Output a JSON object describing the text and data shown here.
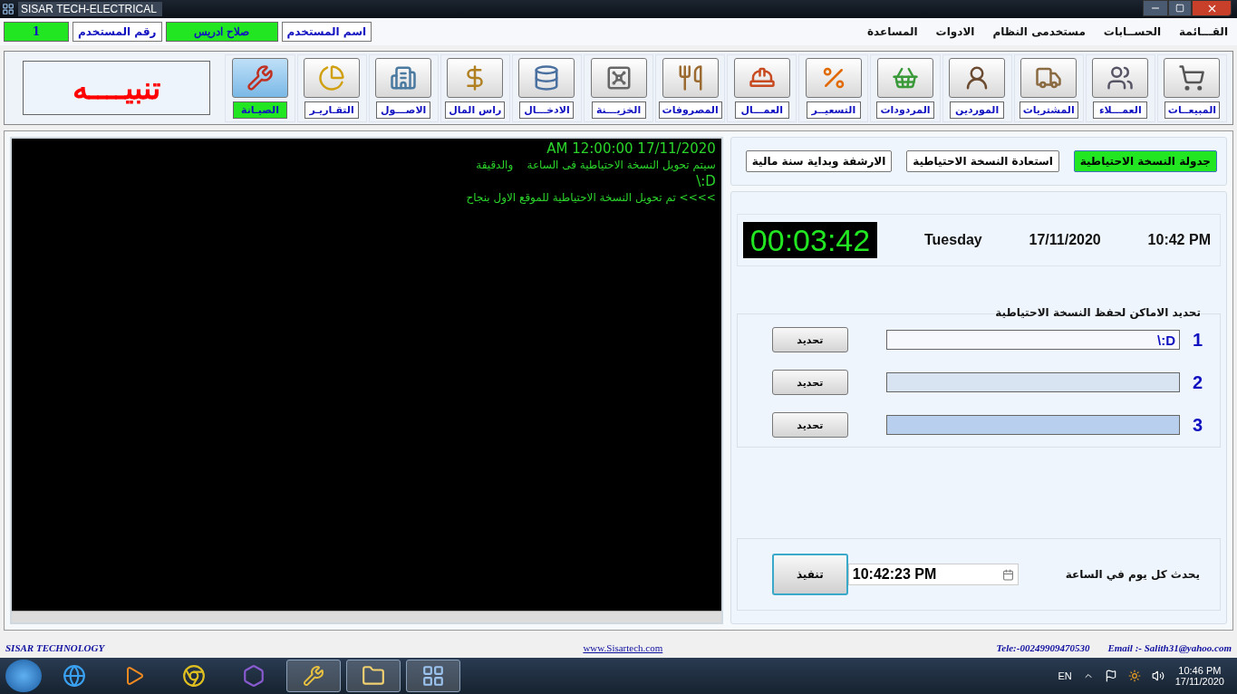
{
  "window": {
    "title": "SISAR TECH-ELECTRICAL"
  },
  "user": {
    "number_label": "رقم المستخدم",
    "number": "1",
    "name_label": "اسم المستخدم",
    "name": "صلاح ادريس"
  },
  "menu": [
    "القـــائمة",
    "الحســابات",
    "مستخدمى النظام",
    "الادوات",
    "المساعدة"
  ],
  "toolbar": [
    {
      "label": "المبيعــات",
      "selected": false
    },
    {
      "label": "العمـــلاء",
      "selected": false
    },
    {
      "label": "المشتريات",
      "selected": false
    },
    {
      "label": "الموردين",
      "selected": false
    },
    {
      "label": "المردودات",
      "selected": false
    },
    {
      "label": "التسعيــر",
      "selected": false
    },
    {
      "label": "العمـــال",
      "selected": false
    },
    {
      "label": "المصروفات",
      "selected": false
    },
    {
      "label": "الخزيـــنة",
      "selected": false
    },
    {
      "label": "الادخـــال",
      "selected": false
    },
    {
      "label": "راس المال",
      "selected": false
    },
    {
      "label": "الاصـــول",
      "selected": false
    },
    {
      "label": "التقـاريـر",
      "selected": false
    },
    {
      "label": "الصيـانة",
      "selected": true
    }
  ],
  "alert": "تنبيــــه",
  "console": [
    {
      "kind": "stamp",
      "text": "AM 12:00:00 17/11/2020"
    },
    {
      "kind": "message",
      "text": "سيتم تحويل النسخة الاحتياطية فى الساعة    والدقيقة"
    },
    {
      "kind": "path",
      "text": "\\:D"
    },
    {
      "kind": "message",
      "text": ">>>> تم تحويل النسخة الاحتياطية للموقع الاول بنجاح"
    }
  ],
  "tabs": [
    {
      "label": "جدولة النسخة الاحتياطية",
      "selected": true
    },
    {
      "label": "استعادة النسخة الاحتياطية",
      "selected": false
    },
    {
      "label": "الارشفة وبداية سنة مالية",
      "selected": false
    }
  ],
  "clock": {
    "elapsed": "00:03:42",
    "day": "Tuesday",
    "date": "17/11/2020",
    "time": "10:42 PM"
  },
  "locations": {
    "title": "تحديد الاماكن لحفظ النسخة الاحتياطية",
    "rows": [
      {
        "number": "1",
        "value": "\\:D",
        "button": "تحديد"
      },
      {
        "number": "2",
        "button": "تحديد"
      },
      {
        "number": "3",
        "button": "تحديد"
      }
    ]
  },
  "schedule": {
    "label": "يحدث كل يوم في الساعة",
    "time": "10:42:23 PM",
    "button": "تنفيذ"
  },
  "footer": {
    "company": "SISAR TECHNOLOGY",
    "website": "www.Sisartech.com",
    "phone": "Tele:-00249909470530",
    "email": "Email :- Salith31@yahoo.com"
  },
  "taskbar": {
    "language": "EN",
    "time": "10:46 PM",
    "date": "17/11/2020"
  }
}
